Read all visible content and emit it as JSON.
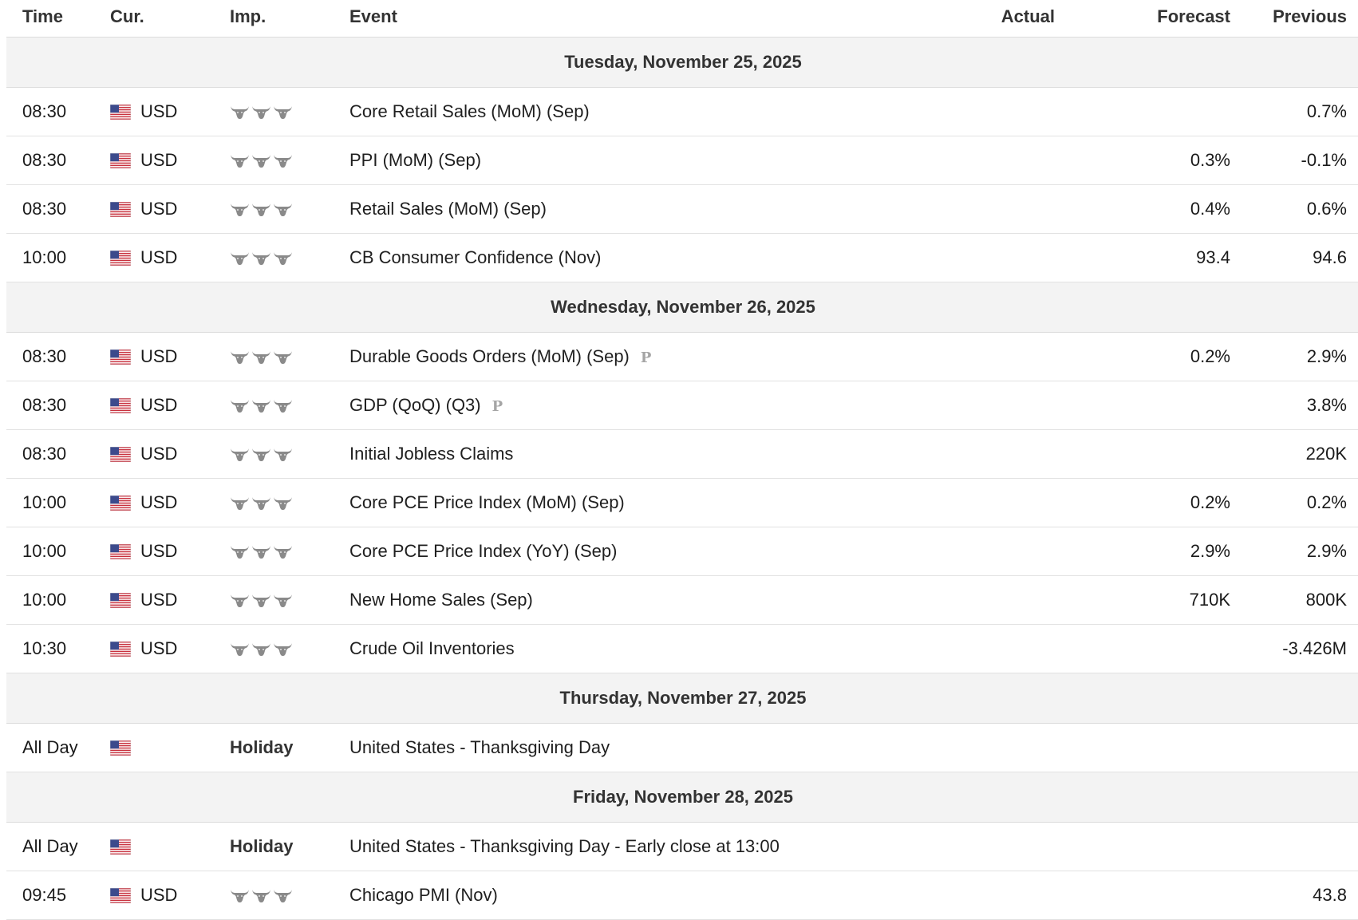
{
  "columns": {
    "time": "Time",
    "currency": "Cur.",
    "importance": "Imp.",
    "event": "Event",
    "actual": "Actual",
    "forecast": "Forecast",
    "previous": "Previous"
  },
  "icons": {
    "flag": "us-flag-icon",
    "importance": "bull-head-icon",
    "preliminary": "preliminary-p-icon"
  },
  "colors": {
    "day_header_bg": "#f3f3f3",
    "bull_icon": "#8a8a8a",
    "preliminary_mark": "#a5a5a5"
  },
  "days": [
    {
      "label": "Tuesday, November 25, 2025",
      "events": [
        {
          "time": "08:30",
          "currency": "USD",
          "importance": 3,
          "event": "Core Retail Sales (MoM) (Sep)",
          "actual": "",
          "forecast": "",
          "previous": "0.7%"
        },
        {
          "time": "08:30",
          "currency": "USD",
          "importance": 3,
          "event": "PPI (MoM) (Sep)",
          "actual": "",
          "forecast": "0.3%",
          "previous": "-0.1%"
        },
        {
          "time": "08:30",
          "currency": "USD",
          "importance": 3,
          "event": "Retail Sales (MoM) (Sep)",
          "actual": "",
          "forecast": "0.4%",
          "previous": "0.6%"
        },
        {
          "time": "10:00",
          "currency": "USD",
          "importance": 3,
          "event": "CB Consumer Confidence (Nov)",
          "actual": "",
          "forecast": "93.4",
          "previous": "94.6"
        }
      ]
    },
    {
      "label": "Wednesday, November 26, 2025",
      "events": [
        {
          "time": "08:30",
          "currency": "USD",
          "importance": 3,
          "event": "Durable Goods Orders (MoM) (Sep)",
          "prelim": "P",
          "actual": "",
          "forecast": "0.2%",
          "previous": "2.9%"
        },
        {
          "time": "08:30",
          "currency": "USD",
          "importance": 3,
          "event": "GDP (QoQ) (Q3)",
          "prelim": "P",
          "actual": "",
          "forecast": "",
          "previous": "3.8%"
        },
        {
          "time": "08:30",
          "currency": "USD",
          "importance": 3,
          "event": "Initial Jobless Claims",
          "actual": "",
          "forecast": "",
          "previous": "220K"
        },
        {
          "time": "10:00",
          "currency": "USD",
          "importance": 3,
          "event": "Core PCE Price Index (MoM) (Sep)",
          "actual": "",
          "forecast": "0.2%",
          "previous": "0.2%"
        },
        {
          "time": "10:00",
          "currency": "USD",
          "importance": 3,
          "event": "Core PCE Price Index (YoY) (Sep)",
          "actual": "",
          "forecast": "2.9%",
          "previous": "2.9%"
        },
        {
          "time": "10:00",
          "currency": "USD",
          "importance": 3,
          "event": "New Home Sales (Sep)",
          "actual": "",
          "forecast": "710K",
          "previous": "800K"
        },
        {
          "time": "10:30",
          "currency": "USD",
          "importance": 3,
          "event": "Crude Oil Inventories",
          "actual": "",
          "forecast": "",
          "previous": "-3.426M"
        }
      ]
    },
    {
      "label": "Thursday, November 27, 2025",
      "events": [
        {
          "time": "All Day",
          "currency": "",
          "holiday": "Holiday",
          "event": "United States - Thanksgiving Day",
          "actual": "",
          "forecast": "",
          "previous": ""
        }
      ]
    },
    {
      "label": "Friday, November 28, 2025",
      "events": [
        {
          "time": "All Day",
          "currency": "",
          "holiday": "Holiday",
          "event": "United States - Thanksgiving Day - Early close at 13:00",
          "actual": "",
          "forecast": "",
          "previous": ""
        },
        {
          "time": "09:45",
          "currency": "USD",
          "importance": 3,
          "event": "Chicago PMI (Nov)",
          "actual": "",
          "forecast": "",
          "previous": "43.8"
        }
      ]
    }
  ]
}
